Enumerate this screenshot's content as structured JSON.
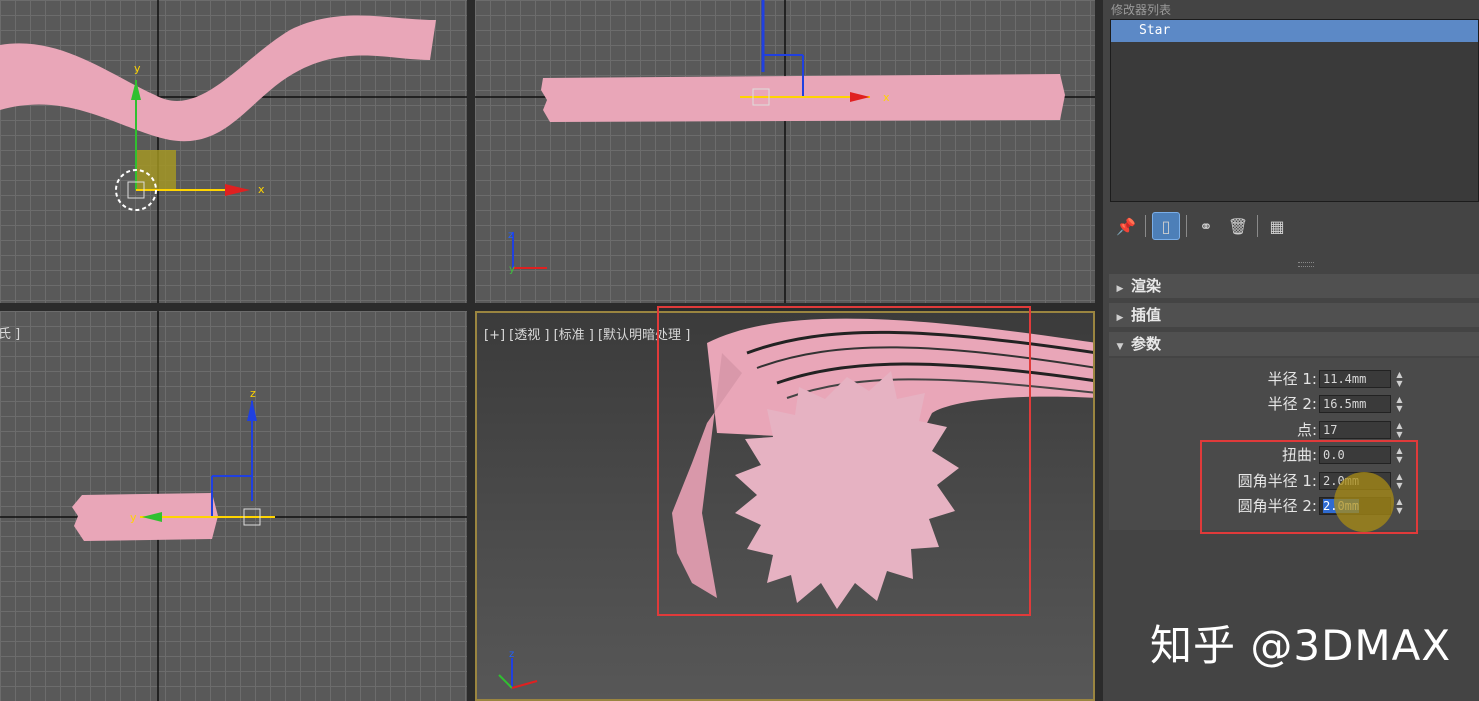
{
  "viewports": {
    "bottom_left_label": "氏 ]",
    "perspective_label": "[+] [透视 ] [标准 ] [默认明暗处理 ]",
    "axis": {
      "x": "x",
      "y": "y",
      "z": "z"
    }
  },
  "panel": {
    "modifier_stack_title": "修改器列表",
    "modifier_items": [
      "Star"
    ],
    "rollouts": {
      "render": "渲染",
      "interpolation": "插值",
      "parameters": "参数"
    },
    "params": [
      {
        "label": "半径 1:",
        "value": "11.4mm"
      },
      {
        "label": "半径 2:",
        "value": "16.5mm"
      },
      {
        "label": "点:",
        "value": "17"
      },
      {
        "label": "扭曲:",
        "value": "0.0"
      },
      {
        "label": "圆角半径 1:",
        "value": "2.0mm"
      },
      {
        "label": "圆角半径 2:",
        "value": "2.0mm"
      }
    ]
  },
  "watermark": "知乎 @3DMAX",
  "colors": {
    "shape_pink": "#e9a6b8",
    "highlight_red": "#e03a3a",
    "selection_blue": "#5c89c6"
  }
}
